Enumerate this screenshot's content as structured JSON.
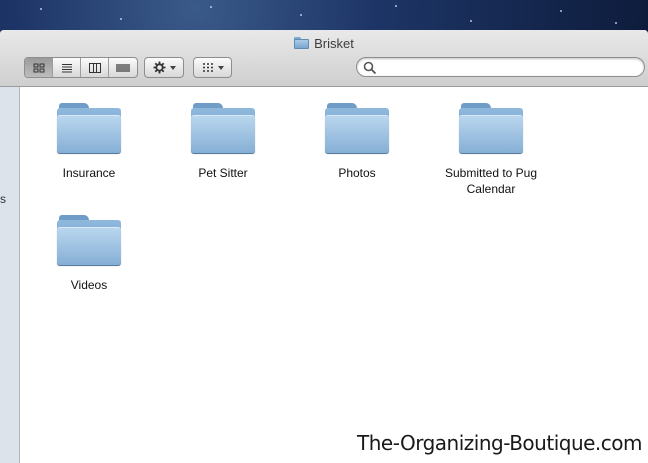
{
  "window": {
    "title": "Brisket"
  },
  "toolbar": {
    "view_buttons": [
      "icon-view-icon",
      "list-view-icon",
      "column-view-icon",
      "cover-flow-icon"
    ],
    "action_icon": "gear-icon",
    "arrange_icon": "arrange-grid-icon",
    "search": {
      "placeholder": "",
      "value": ""
    }
  },
  "sidebar": {
    "fragment": "s"
  },
  "folders": [
    {
      "label": "Insurance"
    },
    {
      "label": "Pet Sitter"
    },
    {
      "label": "Photos"
    },
    {
      "label": "Submitted to Pug Calendar"
    },
    {
      "label": "Videos"
    }
  ],
  "watermark": "The-Organizing-Boutique.com",
  "colors": {
    "folder_blue": "#86afd5",
    "toolbar_gray": "#cfcfcf"
  }
}
